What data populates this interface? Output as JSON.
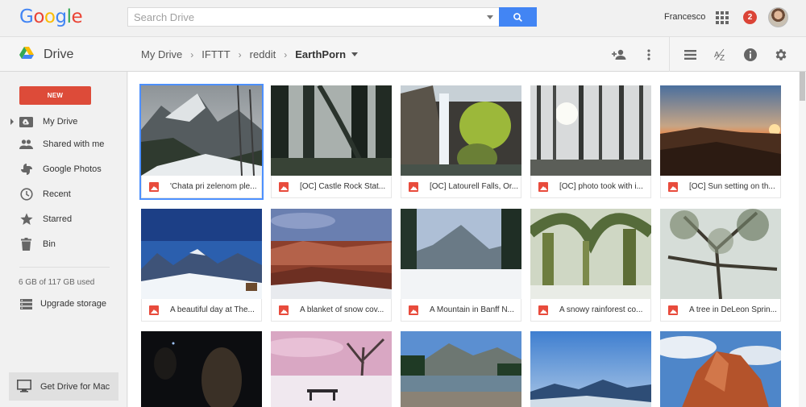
{
  "header": {
    "logo_text": "Google",
    "search_placeholder": "Search Drive",
    "user_name": "Francesco",
    "notification_count": "2"
  },
  "toolbar": {
    "app_title": "Drive",
    "breadcrumbs": [
      "My Drive",
      "IFTTT",
      "reddit",
      "EarthPorn"
    ],
    "icons": [
      "add-person-icon",
      "more-vert-icon",
      "list-view-icon",
      "sort-az-icon",
      "info-icon",
      "settings-icon"
    ]
  },
  "sidebar": {
    "new_label": "NEW",
    "items": [
      {
        "label": "My Drive",
        "icon": "my-drive-icon"
      },
      {
        "label": "Shared with me",
        "icon": "shared-icon"
      },
      {
        "label": "Google Photos",
        "icon": "photos-icon"
      },
      {
        "label": "Recent",
        "icon": "clock-icon"
      },
      {
        "label": "Starred",
        "icon": "star-icon"
      },
      {
        "label": "Bin",
        "icon": "trash-icon"
      }
    ],
    "storage_text": "6 GB of 117 GB used",
    "upgrade_label": "Upgrade storage",
    "get_drive_label": "Get Drive for Mac"
  },
  "files": [
    {
      "name": "'Chata pri zelenom ple...",
      "selected": true
    },
    {
      "name": "[OC] Castle Rock Stat..."
    },
    {
      "name": "[OC] Latourell Falls, Or..."
    },
    {
      "name": "[OC] photo took with i..."
    },
    {
      "name": "[OC] Sun setting on th..."
    },
    {
      "name": "A beautiful day at The..."
    },
    {
      "name": "A blanket of snow cov..."
    },
    {
      "name": "A Mountain in Banff N..."
    },
    {
      "name": "A snowy rainforest co..."
    },
    {
      "name": "A tree in DeLeon Sprin..."
    },
    {
      "name": ""
    },
    {
      "name": ""
    },
    {
      "name": ""
    },
    {
      "name": ""
    },
    {
      "name": ""
    }
  ],
  "colors": {
    "accent_blue": "#4285f4",
    "new_button_red": "#dd4b39",
    "image_file_icon": "#e84b3c"
  }
}
